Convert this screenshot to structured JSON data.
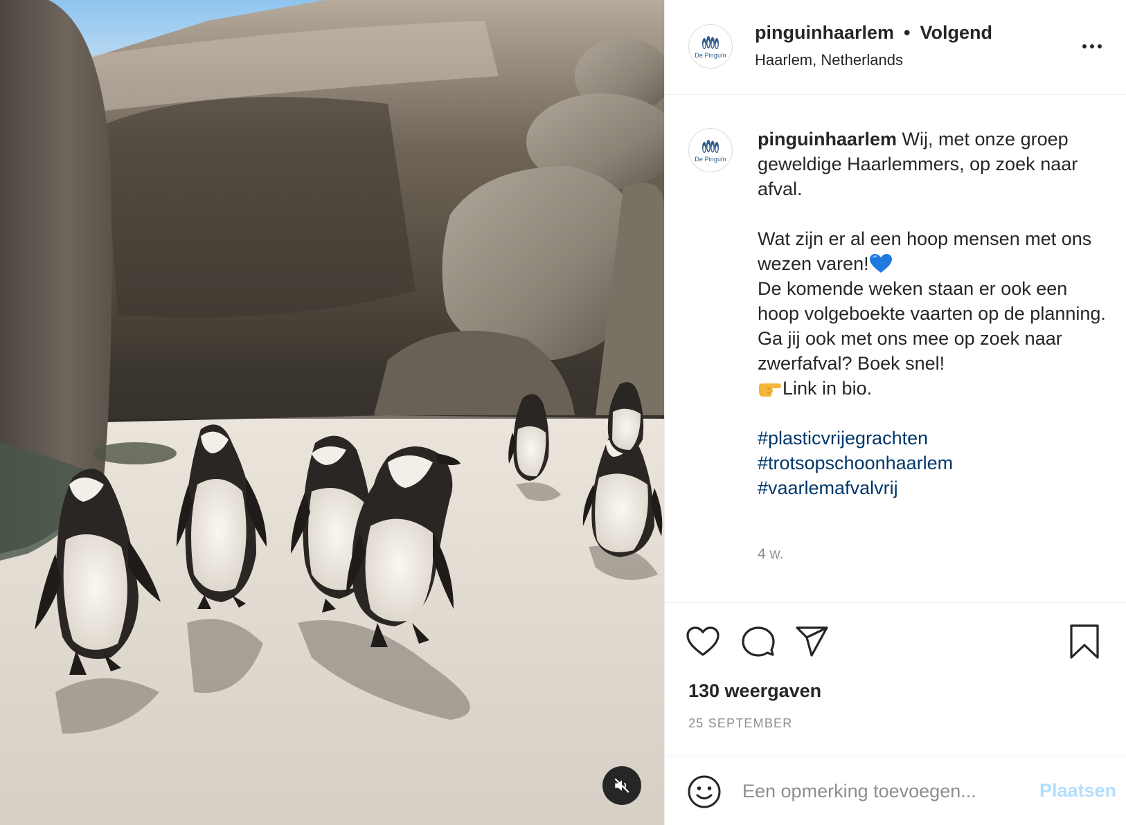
{
  "post": {
    "username": "pinguinhaarlem",
    "follow_status": "Volgend",
    "separator": "•",
    "location": "Haarlem, Netherlands",
    "avatar_logo_text": "De Pinguïn",
    "caption": {
      "line1": "Wij, met onze groep geweldige Haarlemmers, op zoek naar afval.",
      "line2": "Wat zijn er al een hoop mensen met ons wezen varen!",
      "line3": "De komende weken staan er ook een hoop volgeboekte vaarten op de planning.",
      "line4": "Ga jij ook met ons mee op zoek naar zwerfafval? Boek snel!",
      "line5": "Link in bio.",
      "hashtags": [
        "#plasticvrijegrachten",
        "#trotsopschoonhaarlem",
        "#vaarlemafvalvrij"
      ]
    },
    "time_ago": "4 w.",
    "views": "130 weergaven",
    "date": "25 SEPTEMBER"
  },
  "comment": {
    "placeholder": "Een opmerking toevoegen...",
    "post_label": "Plaatsen"
  },
  "icons": {
    "more": "more-options-icon",
    "like": "heart-icon",
    "comment": "comment-bubble-icon",
    "share": "paper-plane-icon",
    "save": "bookmark-icon",
    "emoji": "smiley-icon",
    "mute": "speaker-muted-icon"
  },
  "colors": {
    "hashtag": "#00376b",
    "post_button_disabled": "#b2dffc",
    "secondary_text": "#8e8e8e",
    "divider": "#efefef"
  }
}
